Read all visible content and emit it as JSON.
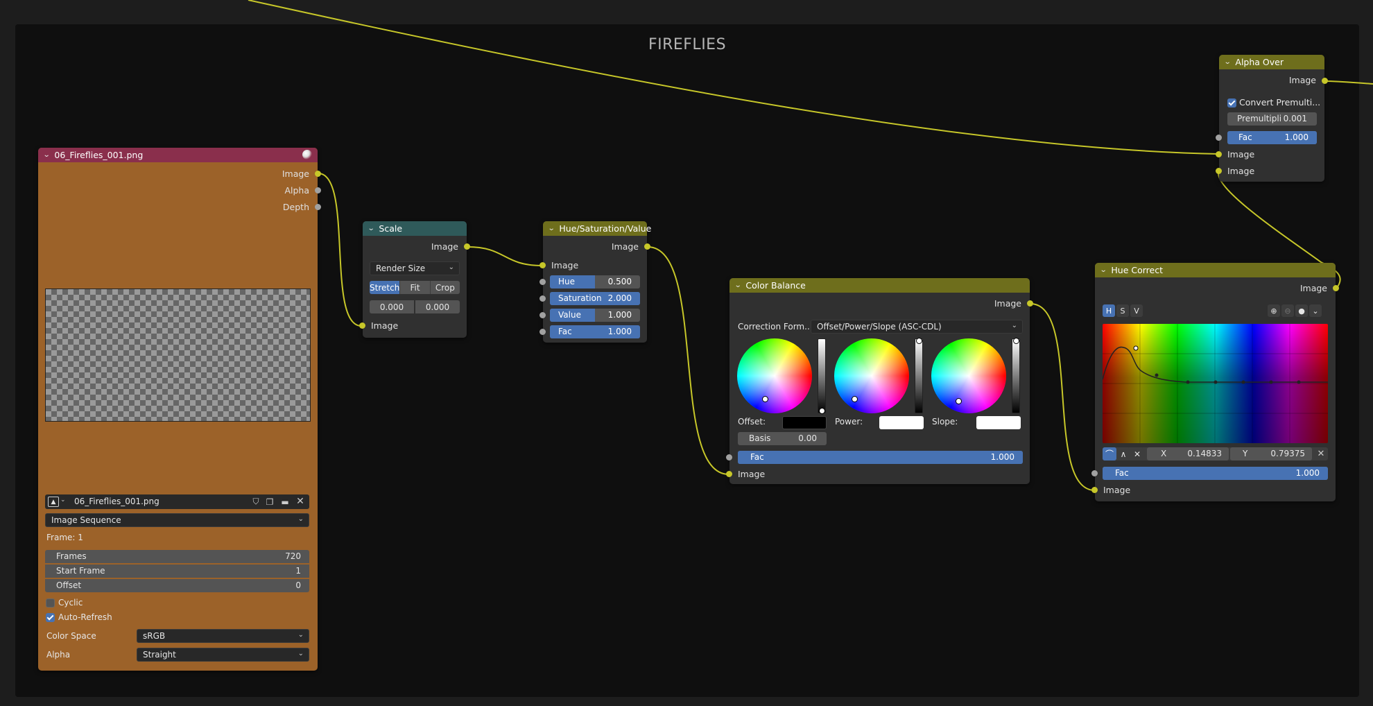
{
  "frame": {
    "label": "FIREFLIES"
  },
  "colors": {
    "socket_image": "#c7c729",
    "socket_value": "#a1a1a1",
    "image_node_header": "#8a2f4c",
    "image_node_body": "#9c6229",
    "scale_header": "#2f5a5a",
    "color_header": "#6e6e1c",
    "accent": "#4772b3"
  },
  "image_node": {
    "title": "06_Fireflies_001.png",
    "outputs": [
      "Image",
      "Alpha",
      "Depth"
    ],
    "file_name": "06_Fireflies_001.png",
    "source": "Image Sequence",
    "frame_text": "Frame: 1",
    "frames": {
      "label": "Frames",
      "value": "720"
    },
    "start_frame": {
      "label": "Start Frame",
      "value": "1"
    },
    "offset": {
      "label": "Offset",
      "value": "0"
    },
    "cyclic": {
      "label": "Cyclic",
      "checked": false
    },
    "auto_refresh": {
      "label": "Auto-Refresh",
      "checked": true
    },
    "color_space": {
      "label": "Color Space",
      "value": "sRGB"
    },
    "alpha": {
      "label": "Alpha",
      "value": "Straight"
    }
  },
  "scale_node": {
    "title": "Scale",
    "output": "Image",
    "space": "Render Size",
    "fit_options": [
      "Stretch",
      "Fit",
      "Crop"
    ],
    "fit_selected": "Stretch",
    "offset_x": "0.000",
    "offset_y": "0.000",
    "input": "Image"
  },
  "hsv_node": {
    "title": "Hue/Saturation/Value",
    "output": "Image",
    "input": "Image",
    "hue": {
      "label": "Hue",
      "value": "0.500",
      "fraction": 0.5
    },
    "saturation": {
      "label": "Saturation",
      "value": "2.000",
      "fraction": 1.0
    },
    "value": {
      "label": "Value",
      "value": "1.000",
      "fraction": 0.5
    },
    "fac": {
      "label": "Fac",
      "value": "1.000",
      "fraction": 1.0
    }
  },
  "color_balance_node": {
    "title": "Color Balance",
    "output": "Image",
    "correction_label": "Correction Form...",
    "correction_value": "Offset/Power/Slope (ASC-CDL)",
    "offset_label": "Offset:",
    "power_label": "Power:",
    "slope_label": "Slope:",
    "offset_color": "#000000",
    "power_color": "#ffffff",
    "slope_color": "#ffffff",
    "basis": {
      "label": "Basis",
      "value": "0.00"
    },
    "fac": {
      "label": "Fac",
      "value": "1.000",
      "fraction": 1.0
    },
    "input": "Image"
  },
  "hue_correct_node": {
    "title": "Hue Correct",
    "output": "Image",
    "channels": [
      "H",
      "S",
      "V"
    ],
    "channel_selected": "H",
    "x_label": "X",
    "x_value": "0.14833",
    "y_label": "Y",
    "y_value": "0.79375",
    "fac": {
      "label": "Fac",
      "value": "1.000",
      "fraction": 1.0
    },
    "input": "Image"
  },
  "alpha_over_node": {
    "title": "Alpha Over",
    "output": "Image",
    "convert_premul": {
      "label": "Convert Premulti...",
      "checked": true
    },
    "premul": {
      "label": "Premultipli",
      "value": "0.001"
    },
    "fac": {
      "label": "Fac",
      "value": "1.000",
      "fraction": 1.0
    },
    "inputs": [
      "Image",
      "Image"
    ]
  }
}
